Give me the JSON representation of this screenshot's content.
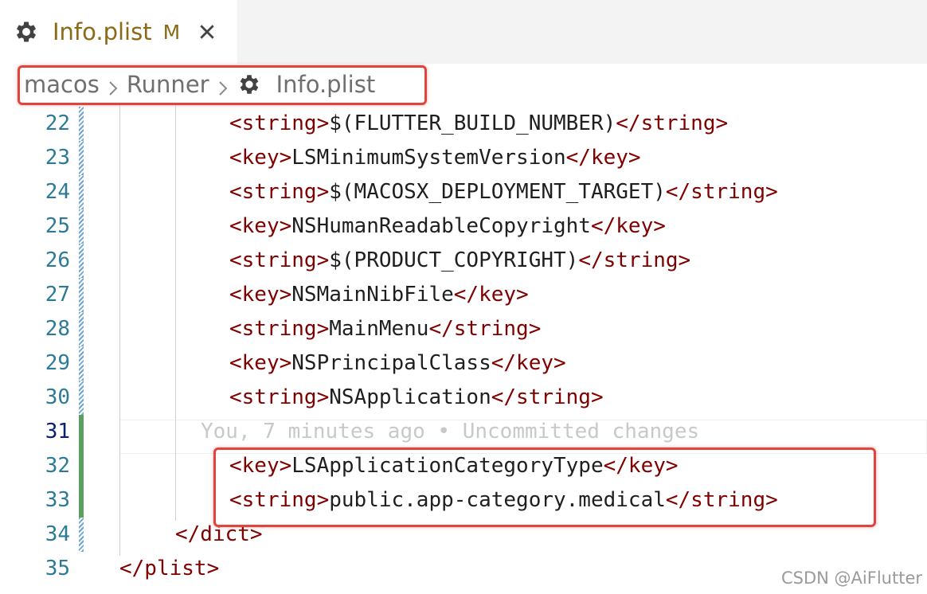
{
  "tab": {
    "title": "Info.plist",
    "modified": "M",
    "icon": "gear-icon",
    "close_icon": "close-icon"
  },
  "breadcrumb": {
    "items": [
      "macos",
      "Runner",
      "Info.plist"
    ],
    "file_icon": "gear-icon"
  },
  "annotation_color": "#e0443c",
  "lines": [
    {
      "num": "22",
      "gutter": "modified",
      "indent": 1,
      "open": "<string>",
      "content": "$(FLUTTER_BUILD_NUMBER)",
      "close": "</string>"
    },
    {
      "num": "23",
      "gutter": "modified",
      "indent": 1,
      "open": "<key>",
      "content": "LSMinimumSystemVersion",
      "close": "</key>"
    },
    {
      "num": "24",
      "gutter": "modified",
      "indent": 1,
      "open": "<string>",
      "content": "$(MACOSX_DEPLOYMENT_TARGET)",
      "close": "</string>"
    },
    {
      "num": "25",
      "gutter": "modified",
      "indent": 1,
      "open": "<key>",
      "content": "NSHumanReadableCopyright",
      "close": "</key>"
    },
    {
      "num": "26",
      "gutter": "modified",
      "indent": 1,
      "open": "<string>",
      "content": "$(PRODUCT_COPYRIGHT)",
      "close": "</string>"
    },
    {
      "num": "27",
      "gutter": "modified",
      "indent": 1,
      "open": "<key>",
      "content": "NSMainNibFile",
      "close": "</key>"
    },
    {
      "num": "28",
      "gutter": "modified",
      "indent": 1,
      "open": "<string>",
      "content": "MainMenu",
      "close": "</string>"
    },
    {
      "num": "29",
      "gutter": "modified",
      "indent": 1,
      "open": "<key>",
      "content": "NSPrincipalClass",
      "close": "</key>"
    },
    {
      "num": "30",
      "gutter": "modified",
      "indent": 1,
      "open": "<string>",
      "content": "NSApplication",
      "close": "</string>"
    },
    {
      "num": "31",
      "gutter": "added",
      "active": true,
      "blame": "You, 7 minutes ago • Uncommitted changes"
    },
    {
      "num": "32",
      "gutter": "added",
      "indent": 1,
      "open": "<key>",
      "content": "LSApplicationCategoryType",
      "close": "</key>"
    },
    {
      "num": "33",
      "gutter": "added",
      "indent": 1,
      "open": "<string>",
      "content": "public.app-category.medical",
      "close": "</string>"
    },
    {
      "num": "34",
      "gutter": "modified",
      "indent": 0,
      "open": "</dict>",
      "content": "",
      "close": ""
    },
    {
      "num": "35",
      "gutter": "none",
      "indent": -1,
      "open": "</plist>",
      "content": "",
      "close": ""
    }
  ],
  "watermark": "CSDN @AiFlutter"
}
